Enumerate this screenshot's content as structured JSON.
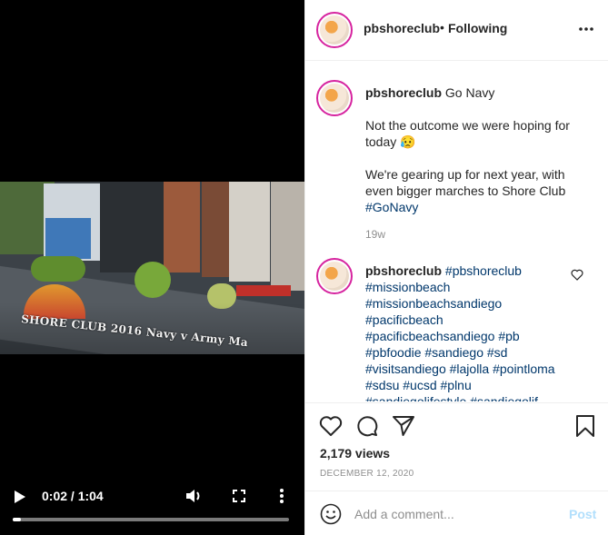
{
  "video": {
    "overlay_text": "SHORE CLUB  2016 Navy v Army Ma",
    "time": "0:02 / 1:04",
    "progress_fraction": 0.03
  },
  "post": {
    "author": "pbshoreclub",
    "follow_dot": "•",
    "follow_status": "Following",
    "caption_title": "Go Navy",
    "caption_line1": "Not the outcome we were hoping for today 😥",
    "caption_line2": "We're gearing up for next year, with even bigger marches to Shore Club",
    "caption_hashtag": "#GoNavy",
    "age": "19w",
    "comment_author": "pbshoreclub",
    "comment_hashtags": "#pbshoreclub #missionbeach #missionbeachsandiego #pacificbeach #pacificbeachsandiego #pb #pbfoodie #sandiego #sd #visitsandiego #lajolla #pointloma #sdsu #ucsd #plnu #sandiegolifestyle #sandiegolif",
    "views": "2,179 views",
    "date": "DECEMBER 12, 2020"
  },
  "comment_box": {
    "placeholder": "Add a comment...",
    "post_label": "Post"
  },
  "icons": {
    "like": "heart-icon",
    "comment": "comment-bubble-icon",
    "share": "paper-plane-icon",
    "save": "bookmark-icon",
    "emoji": "smiley-icon",
    "more": "more-horizontal-icon"
  },
  "colors": {
    "hashtag": "#00376b",
    "story_ring": "#d6249f",
    "post_disabled": "#b2dffc"
  }
}
